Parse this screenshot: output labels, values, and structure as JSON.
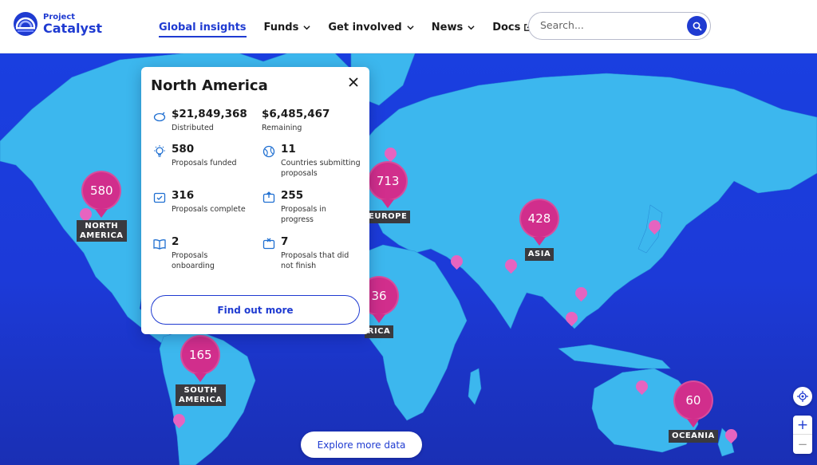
{
  "brand": {
    "line1": "Project",
    "line2": "Catalyst",
    "color": "#1f3bd1"
  },
  "nav": [
    {
      "label": "Global insights",
      "active": true
    },
    {
      "label": "Funds",
      "dropdown": true
    },
    {
      "label": "Get involved",
      "dropdown": true
    },
    {
      "label": "News",
      "dropdown": true
    },
    {
      "label": "Docs",
      "external": true
    }
  ],
  "search": {
    "placeholder": "Search...",
    "icon": "search-icon"
  },
  "regions": [
    {
      "name": "NORTH AMERICA",
      "line1": "NORTH",
      "line2": "AMERICA",
      "count": "580"
    },
    {
      "name": "EUROPE",
      "count": "713"
    },
    {
      "name": "ASIA",
      "count": "428"
    },
    {
      "name": "AFRICA",
      "label_visible": "RICA",
      "count_visible": "36"
    },
    {
      "name": "SOUTH AMERICA",
      "line1": "SOUTH",
      "line2": "AMERICA",
      "count": "165"
    },
    {
      "name": "OCEANIA",
      "count": "60"
    }
  ],
  "panel": {
    "title": "North America",
    "stats": [
      {
        "icon": "piggy-bank-icon",
        "value": "$21,849,368",
        "label": "Distributed"
      },
      {
        "icon": "wallet-icon",
        "value": "$6,485,467",
        "label": "Remaining"
      },
      {
        "icon": "lightbulb-icon",
        "value": "580",
        "label": "Proposals funded"
      },
      {
        "icon": "globe-icon",
        "value": "11",
        "label": "Countries submitting proposals"
      },
      {
        "icon": "check-box-icon",
        "value": "316",
        "label": "Proposals complete"
      },
      {
        "icon": "progress-icon",
        "value": "255",
        "label": "Proposals in progress"
      },
      {
        "icon": "book-icon",
        "value": "2",
        "label": "Proposals onboarding"
      },
      {
        "icon": "x-box-icon",
        "value": "7",
        "label": "Proposals that did not finish"
      }
    ],
    "button": "Find out more"
  },
  "explore_button": "Explore more data",
  "map_controls": {
    "locate_icon": "locate-icon",
    "zoom_in": "+",
    "zoom_out": "−"
  },
  "colors": {
    "ocean": "#1c3ad8",
    "land": "#3cb7ee",
    "pin": "#d12e8c",
    "dot": "#e664c0",
    "label_bg": "#3a3a3f"
  }
}
